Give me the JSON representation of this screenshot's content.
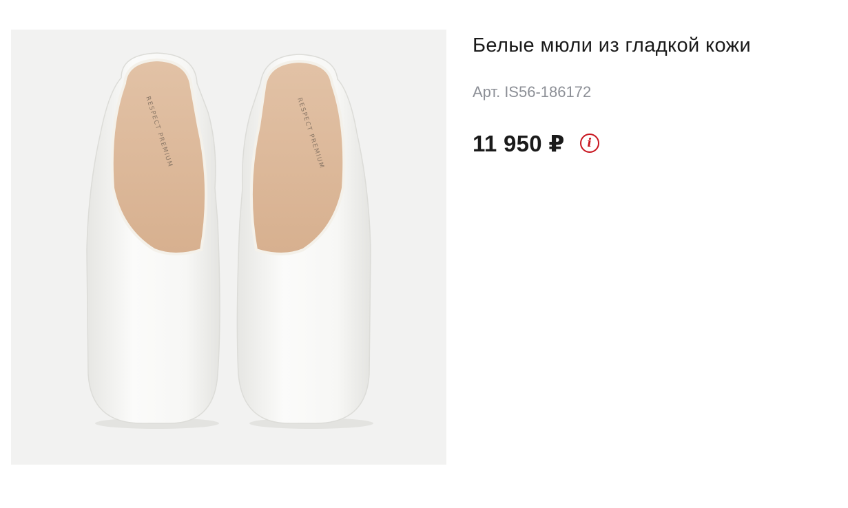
{
  "product": {
    "image_alt": "White smooth leather mules, top view",
    "insole_brand": "RESPECT PREMIUM",
    "title": "Белые мюли из гладкой кожи",
    "sku_label": "Арт.",
    "sku": "IS56-186172",
    "price": "11 950 ₽",
    "info_icon": "info-icon",
    "colors": {
      "image_bg": "#f2f2f1",
      "accent": "#c8141e",
      "sku_text": "#8c8f96",
      "text": "#1a1a1a"
    }
  }
}
